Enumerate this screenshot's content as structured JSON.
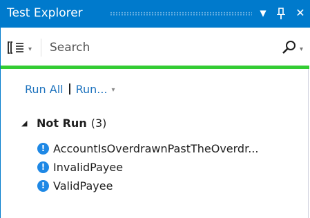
{
  "window": {
    "title": "Test Explorer",
    "dropdown_glyph": "▼",
    "pin_glyph": "ᵻ",
    "close_glyph": "✕"
  },
  "toolbar": {
    "group_by_icon": "group-by-icon",
    "search_placeholder": "Search",
    "search_value": "",
    "caret": "▾"
  },
  "progress": {
    "status": "passed",
    "color": "#33cc33",
    "fraction": 1.0
  },
  "runbar": {
    "run_all_label": "Run All",
    "run_label": "Run...",
    "caret": "▾"
  },
  "group": {
    "arrow": "◢",
    "name": "Not Run",
    "count": "(3)"
  },
  "tests": [
    {
      "name": "AccountIsOverdrawnPastTheOverdr..."
    },
    {
      "name": "InvalidPayee"
    },
    {
      "name": "ValidPayee"
    }
  ],
  "colors": {
    "accent": "#007acc",
    "link": "#1e73be",
    "not_run_icon": "#1e88e5"
  }
}
